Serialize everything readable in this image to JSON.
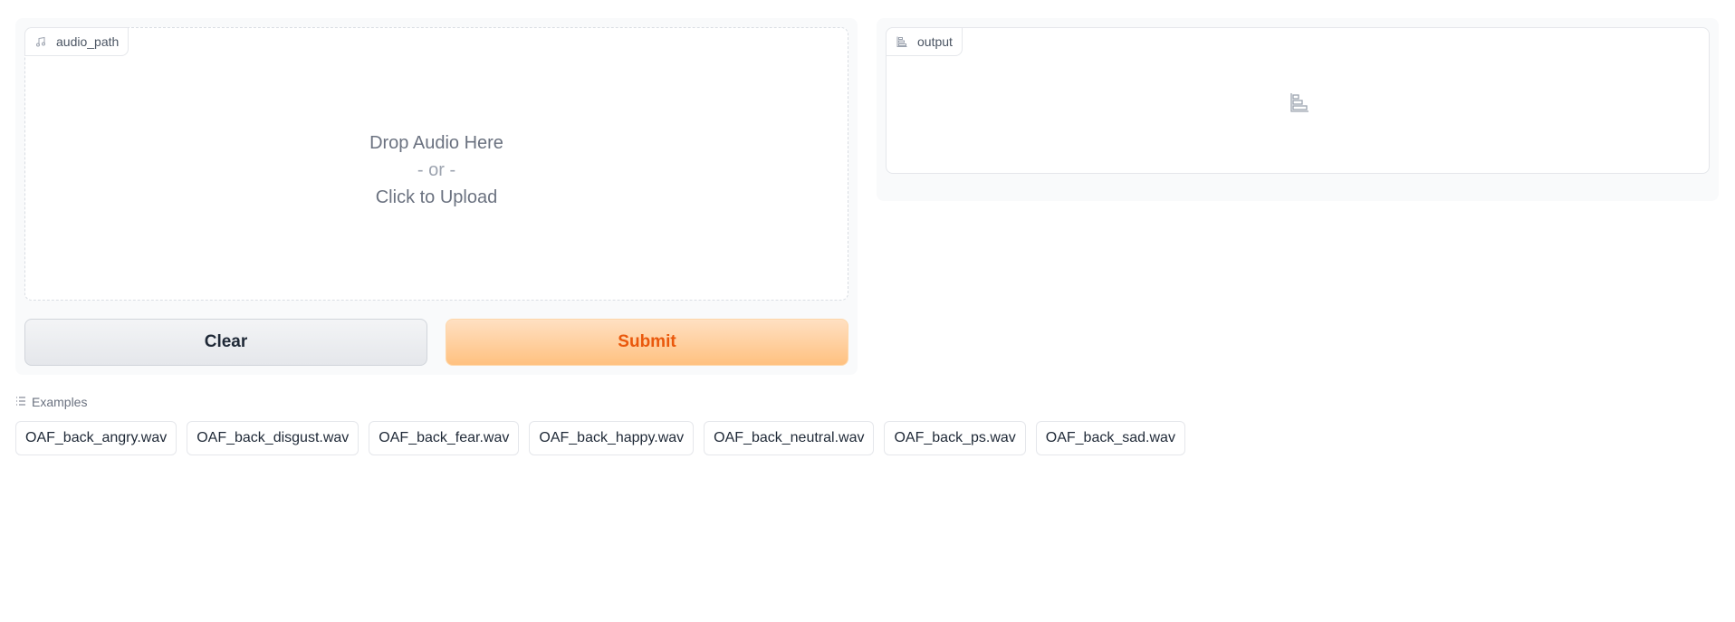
{
  "input": {
    "label": "audio_path",
    "label_icon": "music-note-icon",
    "drop_line1": "Drop Audio Here",
    "drop_line2": "- or -",
    "drop_line3": "Click to Upload"
  },
  "buttons": {
    "clear_label": "Clear",
    "submit_label": "Submit"
  },
  "output": {
    "label": "output",
    "label_icon": "bar-chart-icon",
    "placeholder_icon": "bar-chart-icon"
  },
  "examples": {
    "header": "Examples",
    "header_icon": "list-icon",
    "items": [
      "OAF_back_angry.wav",
      "OAF_back_disgust.wav",
      "OAF_back_fear.wav",
      "OAF_back_happy.wav",
      "OAF_back_neutral.wav",
      "OAF_back_ps.wav",
      "OAF_back_sad.wav"
    ]
  },
  "colors": {
    "accent": "#ea580c",
    "submit_bg": "#ffc180",
    "panel_bg": "#f9fafb"
  }
}
